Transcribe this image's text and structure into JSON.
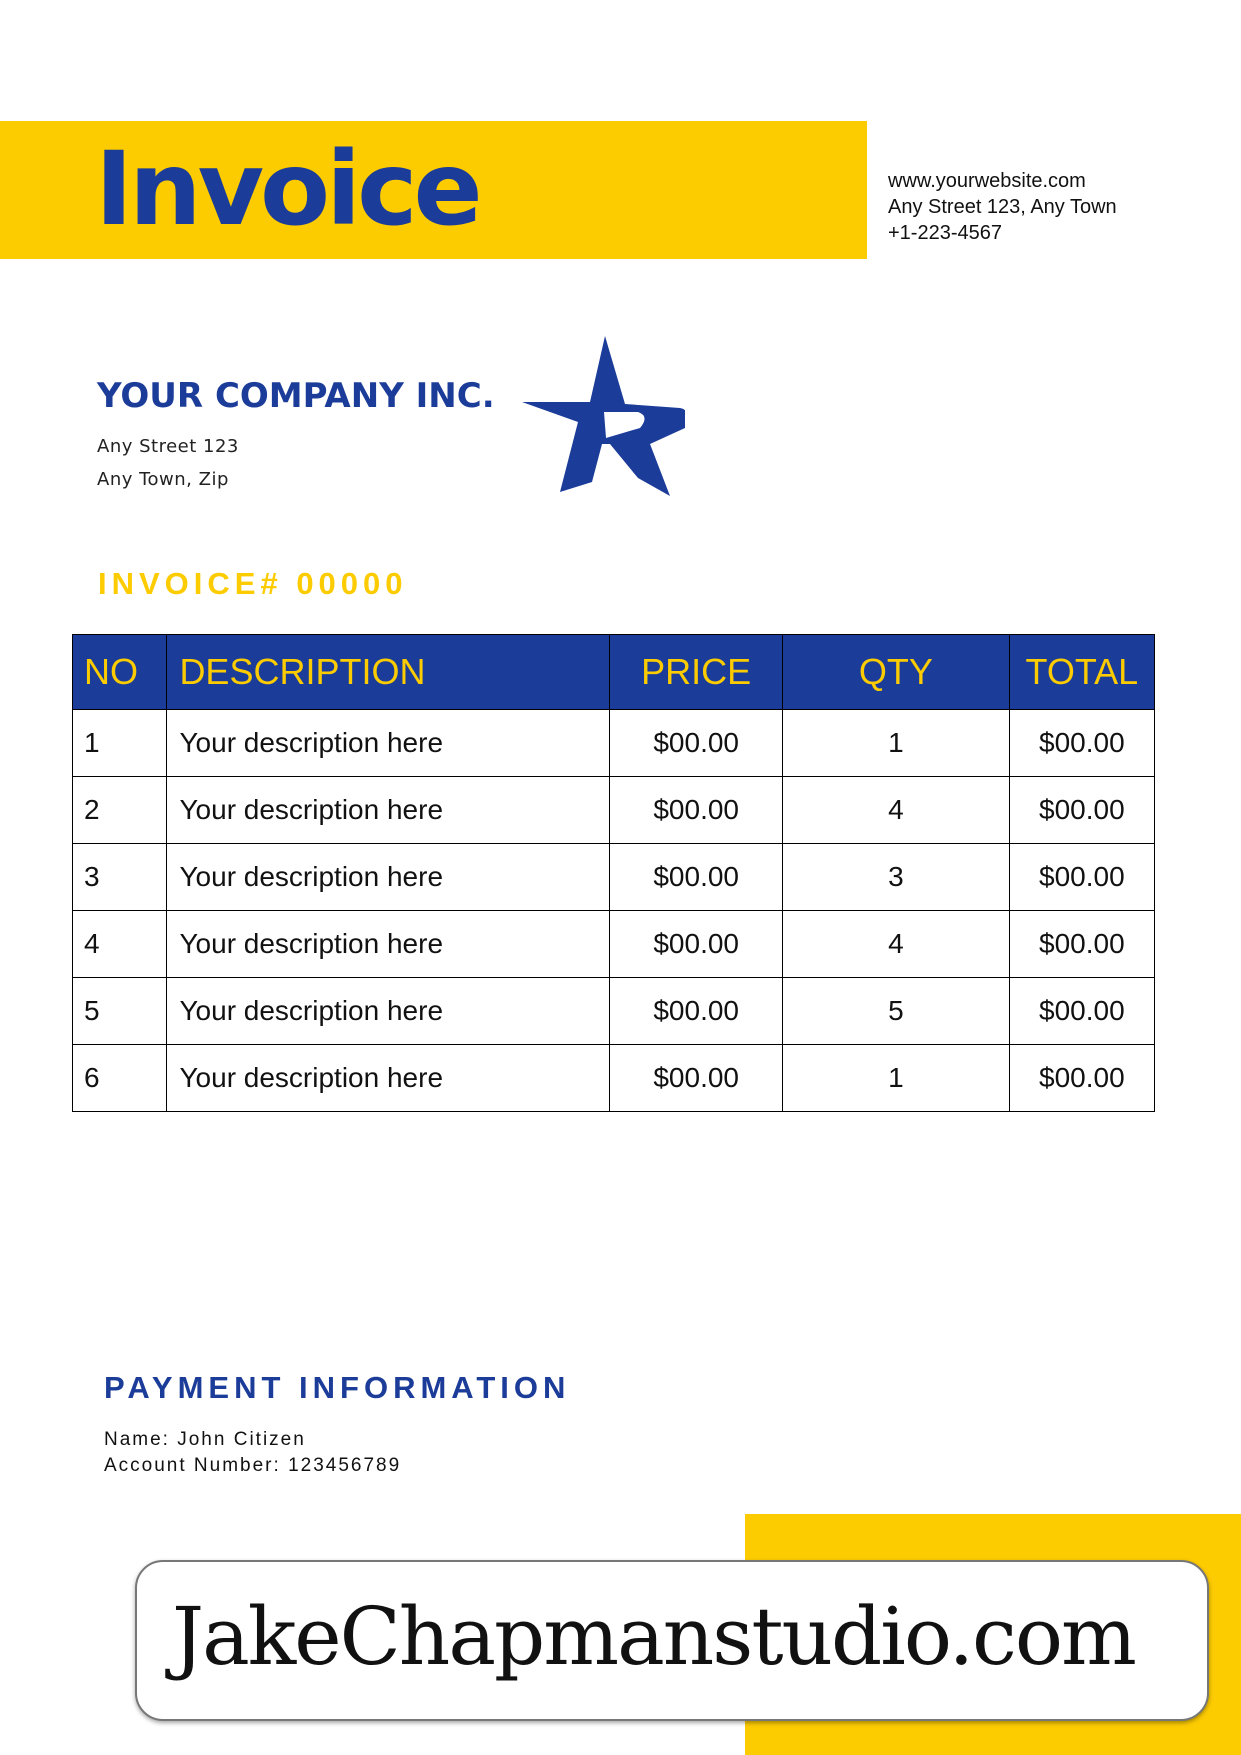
{
  "header": {
    "title": "Invoice",
    "contact": {
      "website": "www.yourwebsite.com",
      "address": "Any Street 123, Any Town",
      "phone": "+1-223-4567"
    }
  },
  "company": {
    "name": "YOUR COMPANY  INC.",
    "address_line1": "Any Street 123",
    "address_line2": "Any Town, Zip",
    "logo_icon": "star-r-logo-icon"
  },
  "invoice_number": "INVOICE# 00000",
  "table": {
    "headers": {
      "no": "NO",
      "description": "DESCRIPTION",
      "price": "PRICE",
      "qty": "QTY",
      "total": "TOTAL"
    },
    "rows": [
      {
        "no": "1",
        "description": "Your description here",
        "price": "$00.00",
        "qty": "1",
        "total": "$00.00"
      },
      {
        "no": "2",
        "description": "Your description here",
        "price": "$00.00",
        "qty": "4",
        "total": "$00.00"
      },
      {
        "no": "3",
        "description": "Your description here",
        "price": "$00.00",
        "qty": "3",
        "total": "$00.00"
      },
      {
        "no": "4",
        "description": "Your description here",
        "price": "$00.00",
        "qty": "4",
        "total": "$00.00"
      },
      {
        "no": "5",
        "description": "Your description here",
        "price": "$00.00",
        "qty": "5",
        "total": "$00.00"
      },
      {
        "no": "6",
        "description": "Your description here",
        "price": "$00.00",
        "qty": "1",
        "total": "$00.00"
      }
    ]
  },
  "payment": {
    "title": "PAYMENT INFORMATION",
    "name": "Name: John Citizen",
    "account": "Account Number: 123456789"
  },
  "watermark": "JakeChapmanstudio.com",
  "colors": {
    "accent_yellow": "#fccb00",
    "brand_blue": "#1b3c99"
  }
}
